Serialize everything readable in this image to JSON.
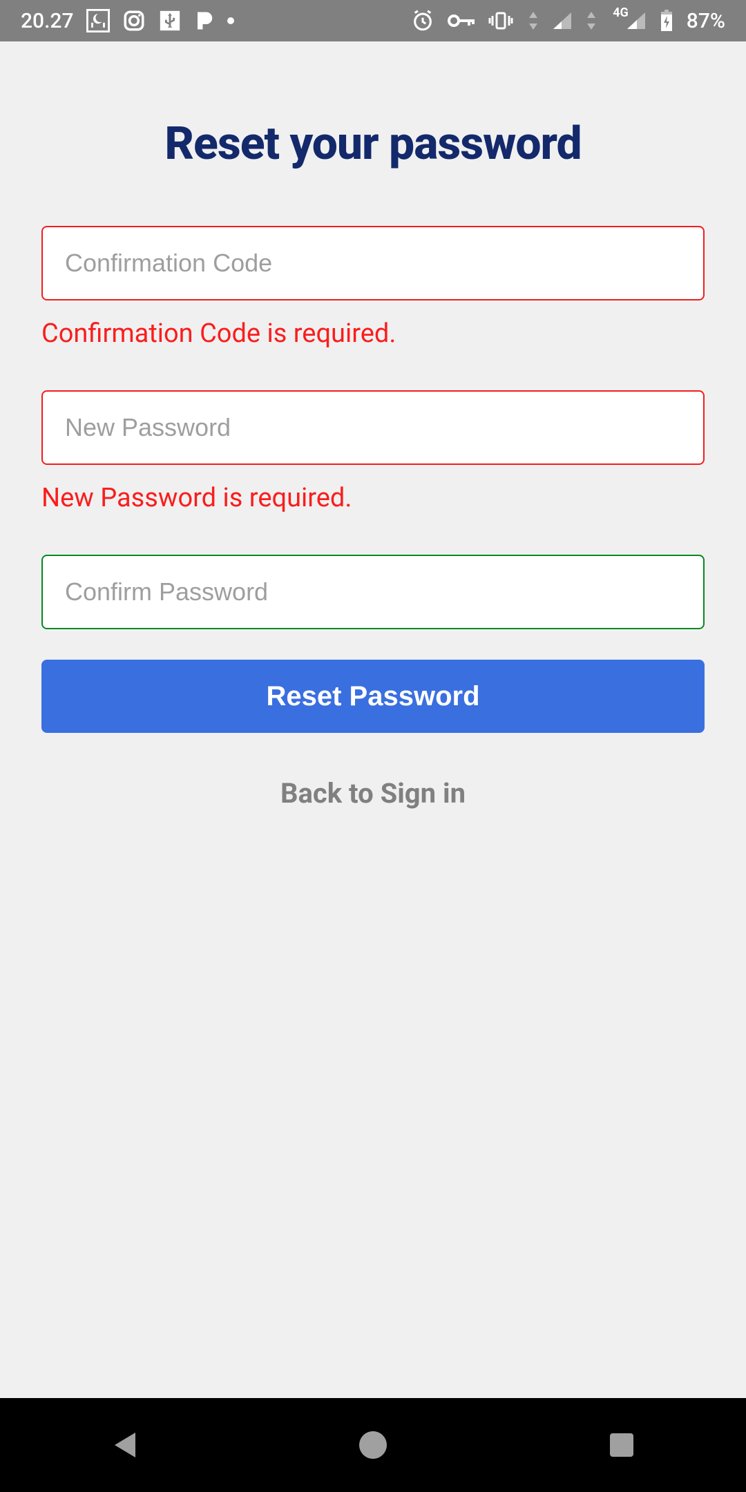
{
  "statusbar": {
    "time": "20.27",
    "battery": "87%",
    "network_label": "4G"
  },
  "page": {
    "title": "Reset your password"
  },
  "fields": {
    "code": {
      "placeholder": "Confirmation Code",
      "error": "Confirmation Code is required."
    },
    "new_password": {
      "placeholder": "New Password",
      "error": "New Password is required."
    },
    "confirm_password": {
      "placeholder": "Confirm Password"
    }
  },
  "buttons": {
    "reset": "Reset Password",
    "back": "Back to Sign in"
  }
}
